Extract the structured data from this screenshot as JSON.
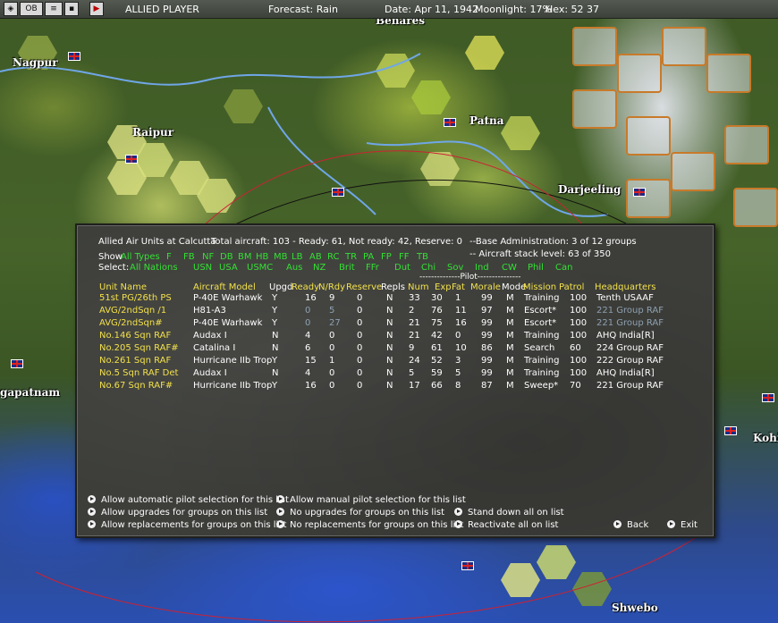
{
  "topbar": {
    "icons": [
      "map-view-icon",
      "ob-icon",
      "list-icon",
      "disk-icon",
      "end-turn-icon"
    ],
    "ob_label": "OB",
    "player": "ALLIED PLAYER",
    "forecast": "Forecast: Rain",
    "date": "Date: Apr 11, 1942",
    "moonlight": "Moonlight: 17%",
    "hex": "Hex: 52  37"
  },
  "map": {
    "cities": [
      "Nagpur",
      "Raipur",
      "Benares",
      "Patna",
      "Darjeeling",
      "gapatnam",
      "Kohi",
      "Shwebo"
    ]
  },
  "panel": {
    "title": "Allied Air Units at Calcutta",
    "total": "Total aircraft: 103 - Ready: 61, Not ready: 42, Reserve: 0",
    "base_admin": "--Base Administration: 3 of 12 groups",
    "stack_level": "-- Aircraft stack level: 63 of 350",
    "show_label": "Show",
    "show_types": [
      "All Types",
      "F",
      "FB",
      "NF",
      "DB",
      "BM",
      "HB",
      "MB",
      "LB",
      "AB",
      "RC",
      "TR",
      "PA",
      "FP",
      "FF",
      "TB"
    ],
    "select_label": "Select:",
    "select_nations": [
      "All Nations",
      "USN",
      "USA",
      "USMC",
      "Aus",
      "NZ",
      "Brit",
      "FFr",
      "Dut",
      "Chi",
      "Sov",
      "Ind",
      "CW",
      "Phil",
      "Can"
    ],
    "pilot_header": "--------------Pilot---------------",
    "columns": {
      "unit": "Unit Name",
      "aircraft": "Aircraft Model",
      "upgd": "Upgd",
      "ready": "Ready",
      "nrdy": "N/Rdy",
      "reserve": "Reserve",
      "repls": "Repls",
      "num": "Num",
      "exp": "Exp",
      "fat": "Fat",
      "morale": "Morale",
      "mode": "Mode",
      "mission": "Mission",
      "patrol": "Patrol",
      "hq": "Headquarters"
    },
    "rows": [
      {
        "unit": "51st PG/26th PS",
        "aircraft": "P-40E Warhawk",
        "upgd": "Y",
        "ready": "16",
        "nrdy": "9",
        "reserve": "0",
        "repls": "N",
        "num": "33",
        "exp": "30",
        "fat": "1",
        "morale": "99",
        "mode": "M",
        "mission": "Training",
        "patrol": "100",
        "hq": "Tenth USAAF",
        "dim": false
      },
      {
        "unit": "AVG/2ndSqn /1",
        "aircraft": "H81-A3",
        "upgd": "Y",
        "ready": "0",
        "nrdy": "5",
        "reserve": "0",
        "repls": "N",
        "num": "2",
        "exp": "76",
        "fat": "11",
        "morale": "97",
        "mode": "M",
        "mission": "Escort*",
        "patrol": "100",
        "hq": "221 Group RAF",
        "dim": true
      },
      {
        "unit": "AVG/2ndSqn#",
        "aircraft": "P-40E Warhawk",
        "upgd": "Y",
        "ready": "0",
        "nrdy": "27",
        "reserve": "0",
        "repls": "N",
        "num": "21",
        "exp": "75",
        "fat": "16",
        "morale": "99",
        "mode": "M",
        "mission": "Escort*",
        "patrol": "100",
        "hq": "221 Group RAF",
        "dim": true
      },
      {
        "unit": "No.146 Sqn RAF",
        "aircraft": "Audax I",
        "upgd": "N",
        "ready": "4",
        "nrdy": "0",
        "reserve": "0",
        "repls": "N",
        "num": "21",
        "exp": "42",
        "fat": "0",
        "morale": "99",
        "mode": "M",
        "mission": "Training",
        "patrol": "100",
        "hq": "AHQ India[R]",
        "dim": false
      },
      {
        "unit": "No.205 Sqn RAF#",
        "aircraft": "Catalina I",
        "upgd": "N",
        "ready": "6",
        "nrdy": "0",
        "reserve": "0",
        "repls": "N",
        "num": "9",
        "exp": "61",
        "fat": "10",
        "morale": "86",
        "mode": "M",
        "mission": "Search",
        "patrol": "60",
        "hq": "224 Group RAF",
        "dim": false
      },
      {
        "unit": "No.261 Sqn RAF",
        "aircraft": "Hurricane IIb Trop",
        "upgd": "Y",
        "ready": "15",
        "nrdy": "1",
        "reserve": "0",
        "repls": "N",
        "num": "24",
        "exp": "52",
        "fat": "3",
        "morale": "99",
        "mode": "M",
        "mission": "Training",
        "patrol": "100",
        "hq": "222 Group RAF",
        "dim": false
      },
      {
        "unit": "No.5 Sqn RAF Det",
        "aircraft": "Audax I",
        "upgd": "N",
        "ready": "4",
        "nrdy": "0",
        "reserve": "0",
        "repls": "N",
        "num": "5",
        "exp": "59",
        "fat": "5",
        "morale": "99",
        "mode": "M",
        "mission": "Training",
        "patrol": "100",
        "hq": "AHQ India[R]",
        "dim": false
      },
      {
        "unit": "No.67 Sqn RAF#",
        "aircraft": "Hurricane IIb Trop",
        "upgd": "Y",
        "ready": "16",
        "nrdy": "0",
        "reserve": "0",
        "repls": "N",
        "num": "17",
        "exp": "66",
        "fat": "8",
        "morale": "87",
        "mode": "M",
        "mission": "Sweep*",
        "patrol": "70",
        "hq": "221 Group RAF",
        "dim": false
      }
    ],
    "options": {
      "auto_pilot": "Allow automatic pilot selection for this list",
      "manual_pilot": "Allow manual pilot selection for this list",
      "allow_upgrades": "Allow upgrades for groups on this list",
      "no_upgrades": "No upgrades for groups on this list",
      "stand_down": "Stand down all on list",
      "allow_repl": "Allow replacements for groups on this list",
      "no_repl": "No replacements for groups on this list",
      "reactivate": "Reactivate all on list",
      "back": "Back",
      "exit": "Exit"
    }
  }
}
